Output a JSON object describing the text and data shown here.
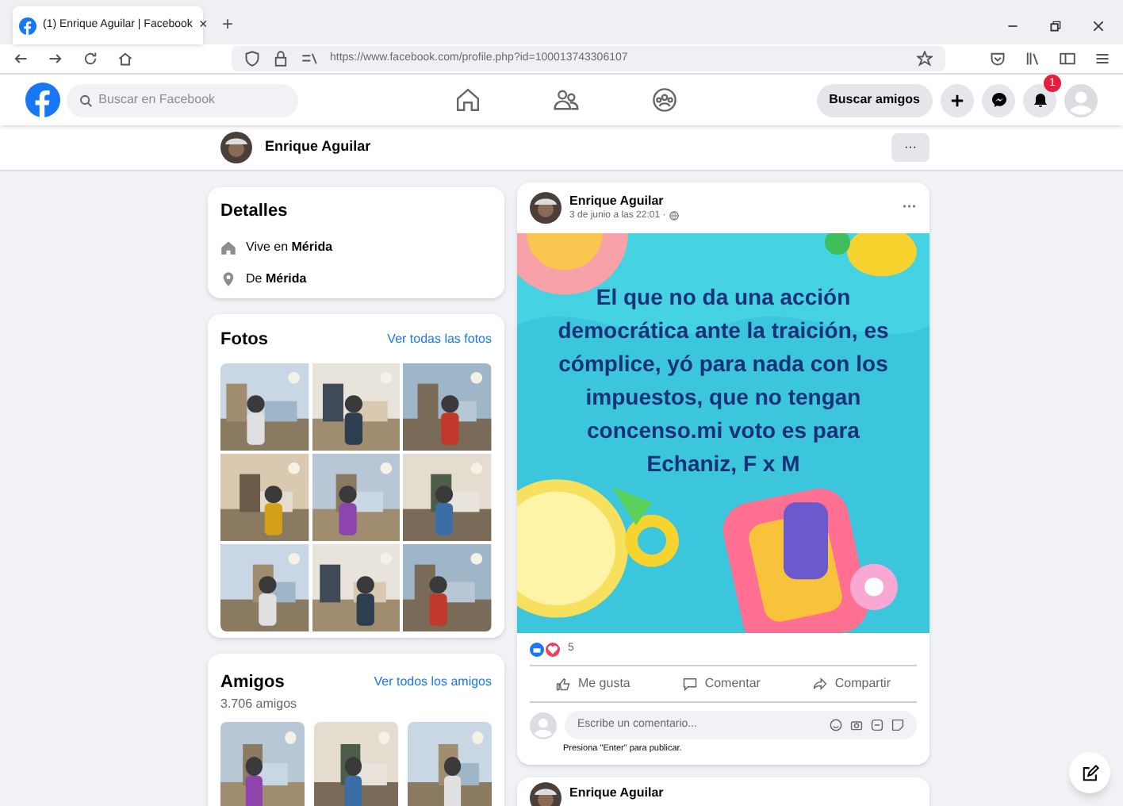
{
  "browser": {
    "tab": {
      "title": "(1) Enrique Aguilar | Facebook",
      "close": "×"
    },
    "new_tab": "+",
    "url": "https://www.facebook.com/profile.php?id=100013743306107"
  },
  "header": {
    "search": {
      "placeholder": "Buscar en Facebook"
    },
    "find_friends": "Buscar amigos",
    "notification_count": "1"
  },
  "profile_bar": {
    "name": "Enrique Aguilar",
    "more": "···"
  },
  "details": {
    "title": "Detalles",
    "items": [
      {
        "kind": "home",
        "text": "Vive en **Mérida**"
      },
      {
        "kind": "pin",
        "text": "De **Mérida**"
      }
    ]
  },
  "photos": {
    "title": "Fotos",
    "link": "Ver todas las fotos"
  },
  "friends": {
    "title": "Amigos",
    "count": "3.706 amigos",
    "link": "Ver todos los amigos"
  },
  "post": {
    "author": "Enrique Aguilar",
    "time": "3 de junio a las 22:01 ·",
    "more": "···",
    "image_text": "El que no da una acción democrática ante la traición, es cómplice, yó para nada con los impuestos, que no tengan concenso.mi voto es para Echaniz, F x M",
    "reaction_count": "5",
    "actions": [
      {
        "kind": "like",
        "label": "Me gusta"
      },
      {
        "kind": "comment",
        "label": "Comentar"
      },
      {
        "kind": "share",
        "label": "Compartir"
      }
    ],
    "comment": {
      "placeholder": "Escribe un comentario...",
      "hint": "Presiona \"Enter\" para publicar."
    }
  },
  "next_post": {
    "author": "Enrique Aguilar"
  }
}
